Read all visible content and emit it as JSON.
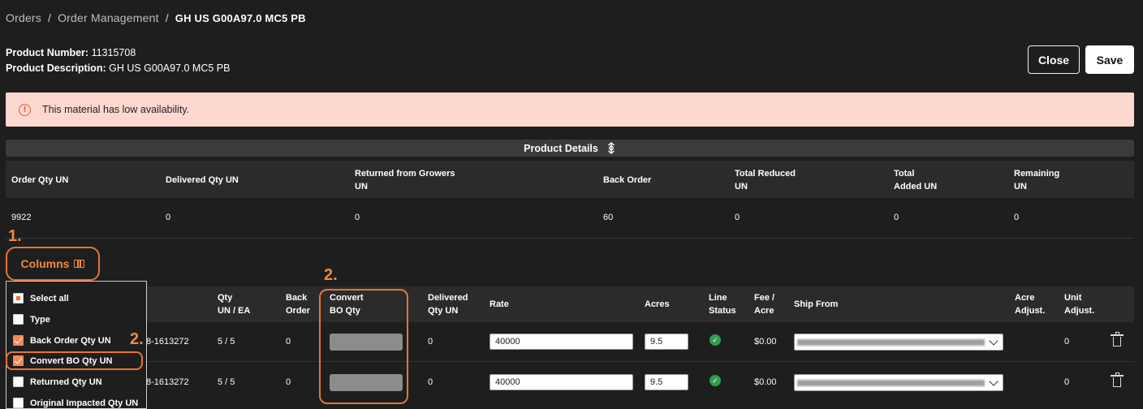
{
  "breadcrumb": {
    "items": [
      "Orders",
      "Order Management"
    ],
    "current": "GH US G00A97.0 MC5 PB",
    "separator": "/"
  },
  "product": {
    "number_label": "Product Number:",
    "number": "11315708",
    "description_label": "Product Description:",
    "description": "GH US G00A97.0 MC5 PB"
  },
  "actions": {
    "close_label": "Close",
    "save_label": "Save"
  },
  "alert": {
    "message": "This material has low availability.",
    "icon": "!"
  },
  "product_details": {
    "title": "Product Details",
    "headers": [
      "Order Qty UN",
      "Delivered Qty UN",
      "Returned from Growers",
      "UN",
      "Back Order",
      "Total Reduced",
      "UN",
      "Total",
      "Added UN",
      "Remaining",
      "UN"
    ],
    "values": [
      "9922",
      "0",
      "0",
      "60",
      "0",
      "0",
      "0"
    ]
  },
  "annotations": {
    "step1": "1.",
    "step2_col": "2.",
    "step2_menu": "2."
  },
  "columns_button": {
    "label": "Columns"
  },
  "column_menu": {
    "items": [
      {
        "label": "Select all",
        "state": "partial"
      },
      {
        "label": "Type",
        "state": "unchecked"
      },
      {
        "label": "Back Order Qty UN",
        "state": "checked"
      },
      {
        "label": "Convert BO Qty UN",
        "state": "checked"
      },
      {
        "label": "Returned Qty UN",
        "state": "unchecked"
      },
      {
        "label": "Original Impacted Qty UN",
        "state": "unchecked"
      }
    ]
  },
  "grid": {
    "headers": {
      "qty": [
        "Qty",
        "UN / EA"
      ],
      "back": [
        "Back",
        "Order"
      ],
      "convert": [
        "Convert",
        "BO Qty"
      ],
      "delivered": [
        "Delivered",
        "Qty UN"
      ],
      "rate": "Rate",
      "acres": "Acres",
      "line_status": [
        "Line",
        "Status"
      ],
      "fee": [
        "Fee /",
        "Acre"
      ],
      "ship_from": "Ship From",
      "acre_adj": [
        "Acre",
        "Adjust."
      ],
      "unit_adj": [
        "Unit",
        "Adjust."
      ]
    },
    "rows": [
      {
        "order": "8-1613272",
        "qty": "5 / 5",
        "back_order": "0",
        "delivered": "0",
        "rate": "40000",
        "acres": "9.5",
        "fee": "$0.00",
        "unit_adjust": "0"
      },
      {
        "order": "8-1613272",
        "qty": "5 / 5",
        "back_order": "0",
        "delivered": "0",
        "rate": "40000",
        "acres": "9.5",
        "fee": "$0.00",
        "unit_adjust": "0"
      }
    ]
  },
  "colors": {
    "accent": "#f08a3c",
    "alert_bg": "#fcd8cf",
    "status_ok": "#2e9e4f"
  }
}
